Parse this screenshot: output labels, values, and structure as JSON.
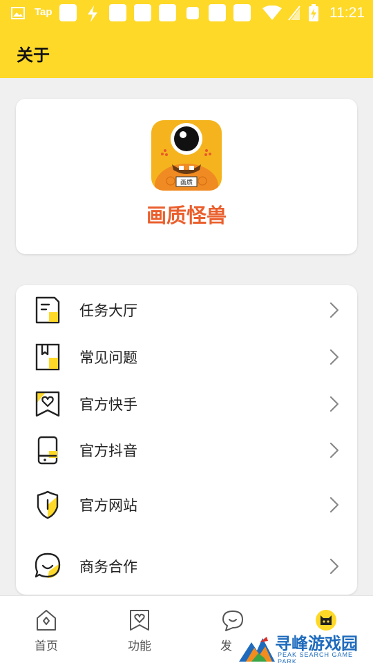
{
  "status_bar": {
    "carrier_text": "Tap",
    "time": "11:21",
    "icons": [
      "image-icon",
      "tap-icon",
      "notification-square-icon",
      "flash-icon",
      "wifi-icon",
      "no-sim-icon",
      "battery-charging-icon"
    ]
  },
  "header": {
    "title": "关于"
  },
  "about": {
    "app_name": "画质怪兽",
    "logo_badge": "画质"
  },
  "menu": {
    "items": [
      {
        "label": "任务大厅",
        "icon": "task-document-icon"
      },
      {
        "label": "常见问题",
        "icon": "faq-book-icon"
      },
      {
        "label": "官方快手",
        "icon": "kuaishou-heart-icon"
      },
      {
        "label": "官方抖音",
        "icon": "douyin-phone-icon"
      },
      {
        "label": "官方网站",
        "icon": "website-shield-icon"
      },
      {
        "label": "商务合作",
        "icon": "business-chat-icon"
      }
    ]
  },
  "tabs": [
    {
      "label": "首页",
      "icon": "home-icon"
    },
    {
      "label": "功能",
      "icon": "feature-heart-icon"
    },
    {
      "label": "发",
      "icon": "discover-chat-icon"
    },
    {
      "label": "",
      "icon": "cat-icon",
      "active": true
    }
  ],
  "watermark": {
    "text": "寻峰游戏园",
    "subtext": "PEAK SEARCH GAME PARK"
  },
  "colors": {
    "accent_yellow": "#fed928",
    "brand_orange": "#ea5f2d",
    "background": "#f0f0f0"
  }
}
